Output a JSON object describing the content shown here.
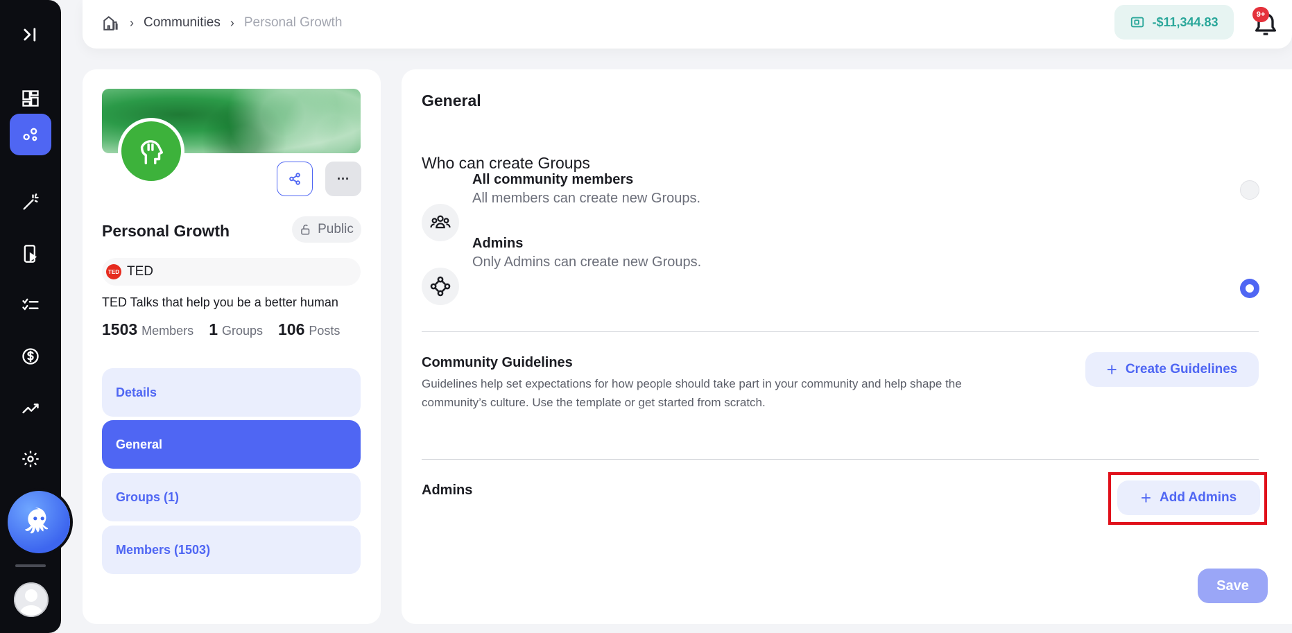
{
  "breadcrumb": {
    "items": [
      "Communities",
      "Personal Growth"
    ]
  },
  "wallet": {
    "balance": "-$11,344.83"
  },
  "notifications": {
    "badge": "9+"
  },
  "community": {
    "name": "Personal Growth",
    "visibility": "Public",
    "org": "TED",
    "org_badge": "TED",
    "description": "TED Talks that help you be a better human",
    "stats": [
      {
        "value": "1503",
        "label": "Members"
      },
      {
        "value": "1",
        "label": "Groups"
      },
      {
        "value": "106",
        "label": "Posts"
      }
    ]
  },
  "nav": {
    "items": [
      {
        "label": "Details",
        "active": false
      },
      {
        "label": "General",
        "active": true
      },
      {
        "label": "Groups (1)",
        "active": false
      },
      {
        "label": "Members (1503)",
        "active": false
      }
    ]
  },
  "general": {
    "title": "General",
    "who_title": "Who can create Groups",
    "options": [
      {
        "title": "All community members",
        "subtitle": "All members can create new Groups.",
        "selected": false
      },
      {
        "title": "Admins",
        "subtitle": "Only Admins can create new Groups.",
        "selected": true
      }
    ],
    "guidelines": {
      "title": "Community Guidelines",
      "description": "Guidelines help set expectations for how people should take part in your community and help shape the community’s culture. Use the template or get started from scratch.",
      "button": "Create Guidelines"
    },
    "admins": {
      "title": "Admins",
      "button": "Add Admins"
    },
    "save": "Save"
  },
  "colors": {
    "accent": "#4f66f3",
    "highlight": "#e0101a",
    "wallet": "#2aa79a"
  }
}
